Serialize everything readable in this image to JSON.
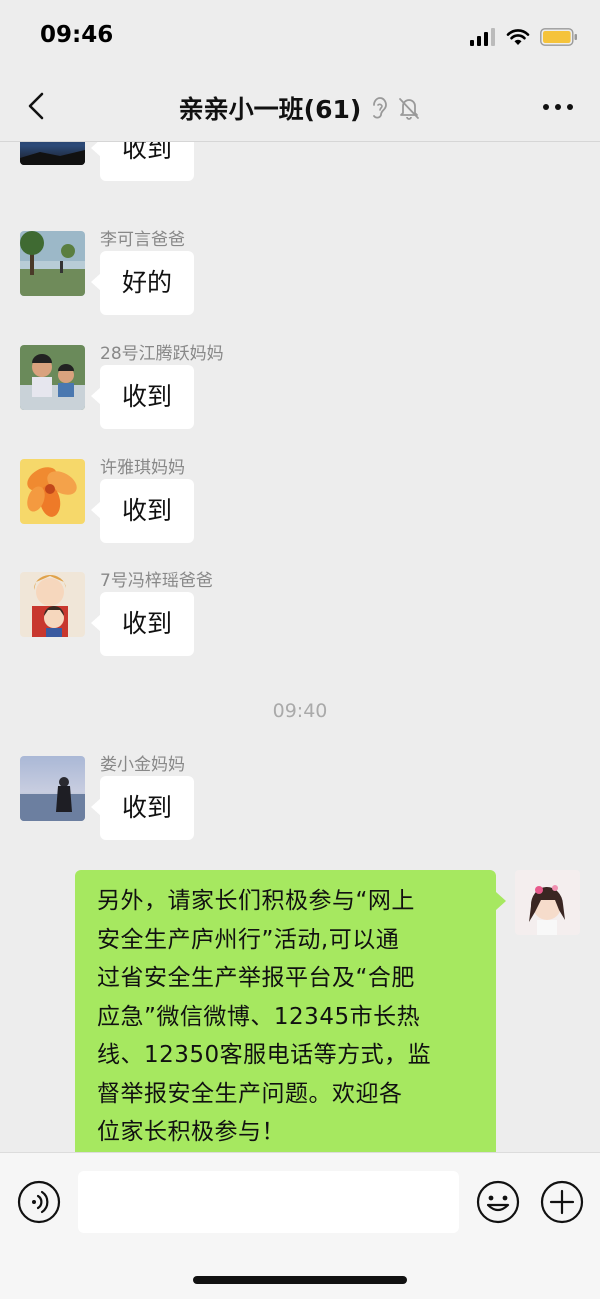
{
  "status_bar": {
    "time": "09:46"
  },
  "nav": {
    "title": "亲亲小一班(61)"
  },
  "messages": [
    {
      "sender": "",
      "text": "收到",
      "avatar": "night-sky-avatar"
    },
    {
      "sender": "李可言爸爸",
      "text": "好的",
      "avatar": "lakeside-tree-avatar"
    },
    {
      "sender": "28号江腾跃妈妈",
      "text": "收到",
      "avatar": "two-kids-avatar"
    },
    {
      "sender": "许雅琪妈妈",
      "text": "收到",
      "avatar": "orange-flower-avatar"
    },
    {
      "sender": "7号冯梓瑶爸爸",
      "text": "收到",
      "avatar": "anime-father-child-avatar"
    },
    {
      "sender": "娄小金妈妈",
      "text": "收到",
      "avatar": "seaside-girl-avatar"
    }
  ],
  "time_separator": "09:40",
  "self_message": {
    "lines": [
      "另外，请家长们积极参与“网上",
      "安全生产庐州行”活动,可以通",
      "过省安全生产举报平台及“合肥",
      "应急”微信微博、12345市长热",
      "线、12350客服电话等方式，监",
      "督举报安全生产问题。欢迎各",
      "位家长积极参与！"
    ]
  },
  "input": {
    "value": "",
    "placeholder": ""
  },
  "colors": {
    "background": "#ededed",
    "self_bubble": "#a6e860",
    "other_bubble": "#ffffff",
    "battery": "#f5c33b"
  },
  "icons": [
    "back-icon",
    "ear-icon",
    "mute-bell-icon",
    "more-icon",
    "voice-icon",
    "emoji-icon",
    "plus-icon",
    "signal-icon",
    "wifi-icon",
    "battery-icon"
  ]
}
